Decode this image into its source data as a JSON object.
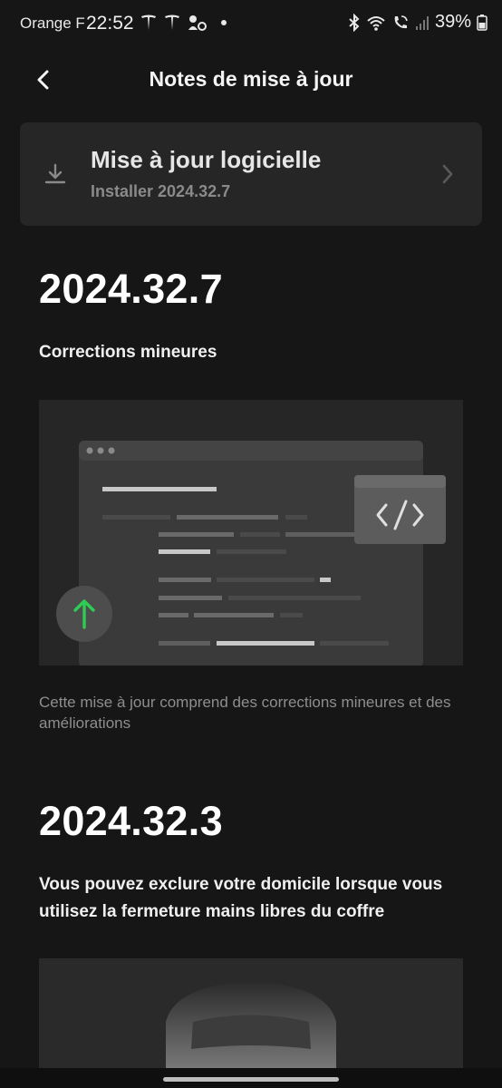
{
  "status_bar": {
    "carrier": "Orange F",
    "time": "22:52",
    "battery": "39%",
    "icons": [
      "tesla-icon",
      "tesla-icon",
      "notification-icon",
      "bluetooth-icon",
      "wifi-icon",
      "wifi-call-icon",
      "signal-icon",
      "battery-icon"
    ]
  },
  "header": {
    "title": "Notes de mise à jour",
    "back_icon": "chevron-left-icon"
  },
  "update_card": {
    "title": "Mise à jour logicielle",
    "subtitle": "Installer 2024.32.7",
    "icon": "download-icon",
    "chevron": "chevron-right-icon"
  },
  "releases": [
    {
      "version": "2024.32.7",
      "title": "Corrections mineures",
      "description": "Cette mise à jour comprend des corrections mineures et des améliorations"
    },
    {
      "version": "2024.32.3",
      "title": "Vous pouvez exclure votre domicile lorsque vous utilisez la fermeture mains libres du coffre"
    }
  ],
  "colors": {
    "background": "#161616",
    "card": "#262626",
    "accent_green": "#2ecc52",
    "muted_text": "#8e8e8e"
  }
}
